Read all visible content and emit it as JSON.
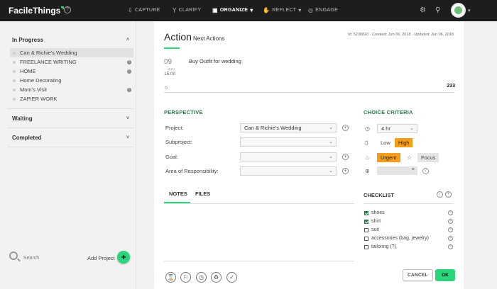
{
  "app": {
    "name": "FacileThings",
    "help_icon": "question-circle-icon"
  },
  "nav": [
    {
      "label": "CAPTURE",
      "icon": "inbox-down-icon"
    },
    {
      "label": "CLARIFY",
      "icon": "funnel-icon"
    },
    {
      "label": "ORGANIZE",
      "icon": "organize-icon"
    },
    {
      "label": "REFLECT",
      "icon": "reflect-icon"
    },
    {
      "label": "ENGAGE",
      "icon": "target-icon"
    }
  ],
  "sidebar": {
    "sections": [
      {
        "title": "In Progress",
        "chevron": "˄"
      },
      {
        "title": "Waiting",
        "chevron": "˅"
      },
      {
        "title": "Completed",
        "chevron": "˅"
      }
    ],
    "projects": [
      {
        "name": "Can & Richie's Wedding",
        "info": false
      },
      {
        "name": "FREELANCE WRITING",
        "info": true
      },
      {
        "name": "HOME",
        "info": true
      },
      {
        "name": "Home Decorating",
        "info": false
      },
      {
        "name": "Mom's Visit",
        "info": true
      },
      {
        "name": "ZAPIER WORK",
        "info": false
      }
    ],
    "search_label": "Search",
    "add_project_label": "Add Project",
    "add_symbol": "+"
  },
  "card": {
    "title": "Action",
    "subtitle": "Next Actions",
    "meta": "Id: 5238820 · Created: Jun 06, 2018 · Updated: Jun 06, 2018",
    "date_day": "09",
    "date_month": "JUN",
    "date_time": "15:00",
    "task": "Buy Outfit for wedding",
    "count": "233"
  },
  "perspective": {
    "heading": "PERSPECTIVE",
    "fields": [
      {
        "label": "Project:",
        "value": "Can & Richie's Wedding",
        "add": true
      },
      {
        "label": "Subproject:",
        "value": "",
        "add": false
      },
      {
        "label": "Goal:",
        "value": "",
        "add": true
      },
      {
        "label": "Area of Responsibility:",
        "value": "",
        "add": true
      }
    ]
  },
  "choice": {
    "heading": "CHOICE CRITERIA",
    "time": "4 hr",
    "energy_low": "Low",
    "energy_high": "High",
    "urgent": "Urgent",
    "focus": "Focus",
    "context_clear": "×"
  },
  "tabs": {
    "notes": "NOTES",
    "files": "FILES"
  },
  "checklist": {
    "heading": "CHECKLIST",
    "items": [
      {
        "text": "shoes",
        "checked": true
      },
      {
        "text": "shirt",
        "checked": true
      },
      {
        "text": "suit",
        "checked": false
      },
      {
        "text": "accessories (bag, jewelry)",
        "checked": false
      },
      {
        "text": "tailoring (?)",
        "checked": false
      }
    ]
  },
  "actions": {
    "icons": [
      "hourglass-icon",
      "bookmark-icon",
      "clock-icon",
      "trash-icon",
      "checkmark-icon"
    ],
    "cancel": "CANCEL",
    "ok": "OK"
  },
  "colors": {
    "accent": "#2bd67b",
    "heading_green": "#2b7a4b",
    "highlight": "#f59e1b",
    "topbar": "#1d1d1d"
  }
}
